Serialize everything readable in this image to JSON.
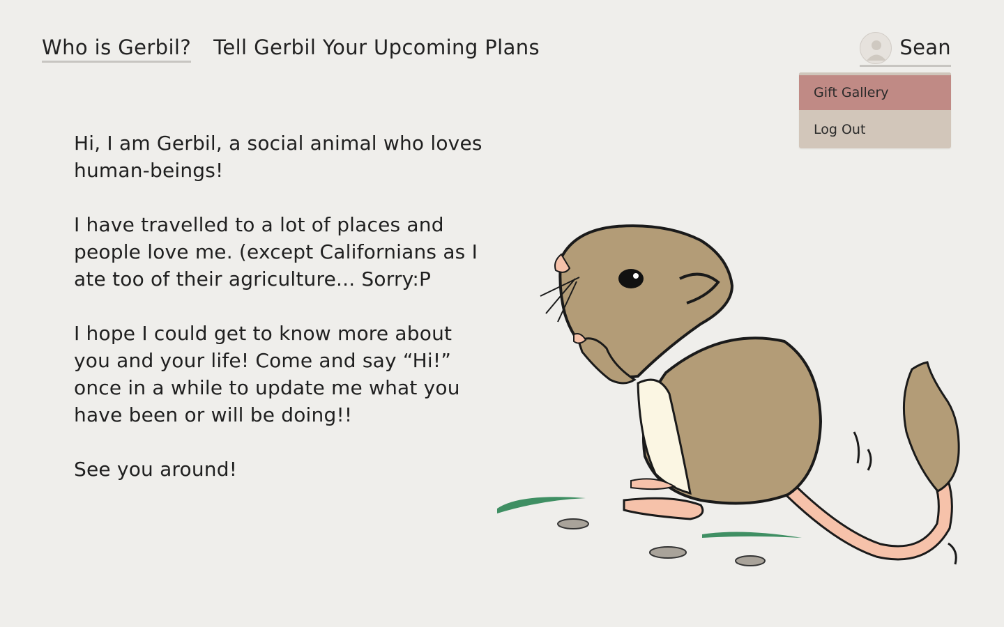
{
  "nav": {
    "items": [
      {
        "label": "Who is Gerbil?",
        "active": true
      },
      {
        "label": "Tell Gerbil Your Upcoming Plans",
        "active": false
      }
    ]
  },
  "user": {
    "name": "Sean",
    "menu": {
      "gift_gallery": "Gift Gallery",
      "log_out": "Log Out"
    }
  },
  "intro": {
    "paragraphs": [
      "Hi, I am Gerbil, a social animal who loves human-beings!",
      "I have travelled to a lot of places and people love me. (except Californians as I ate too of their agriculture... Sorry:P",
      "I hope I could get to know more about you and your life! Come and say “Hi!” once in a while to update me what you have been or will be doing!!",
      "See you around!"
    ]
  },
  "colors": {
    "background": "#efeeeb",
    "menu_highlight": "#c08a85",
    "menu_bg": "#d2c6ba",
    "gerbil_fur": "#b39c77",
    "gerbil_belly": "#fbf6e3",
    "gerbil_pink": "#f6c2aa",
    "grass": "#3f8f63"
  }
}
